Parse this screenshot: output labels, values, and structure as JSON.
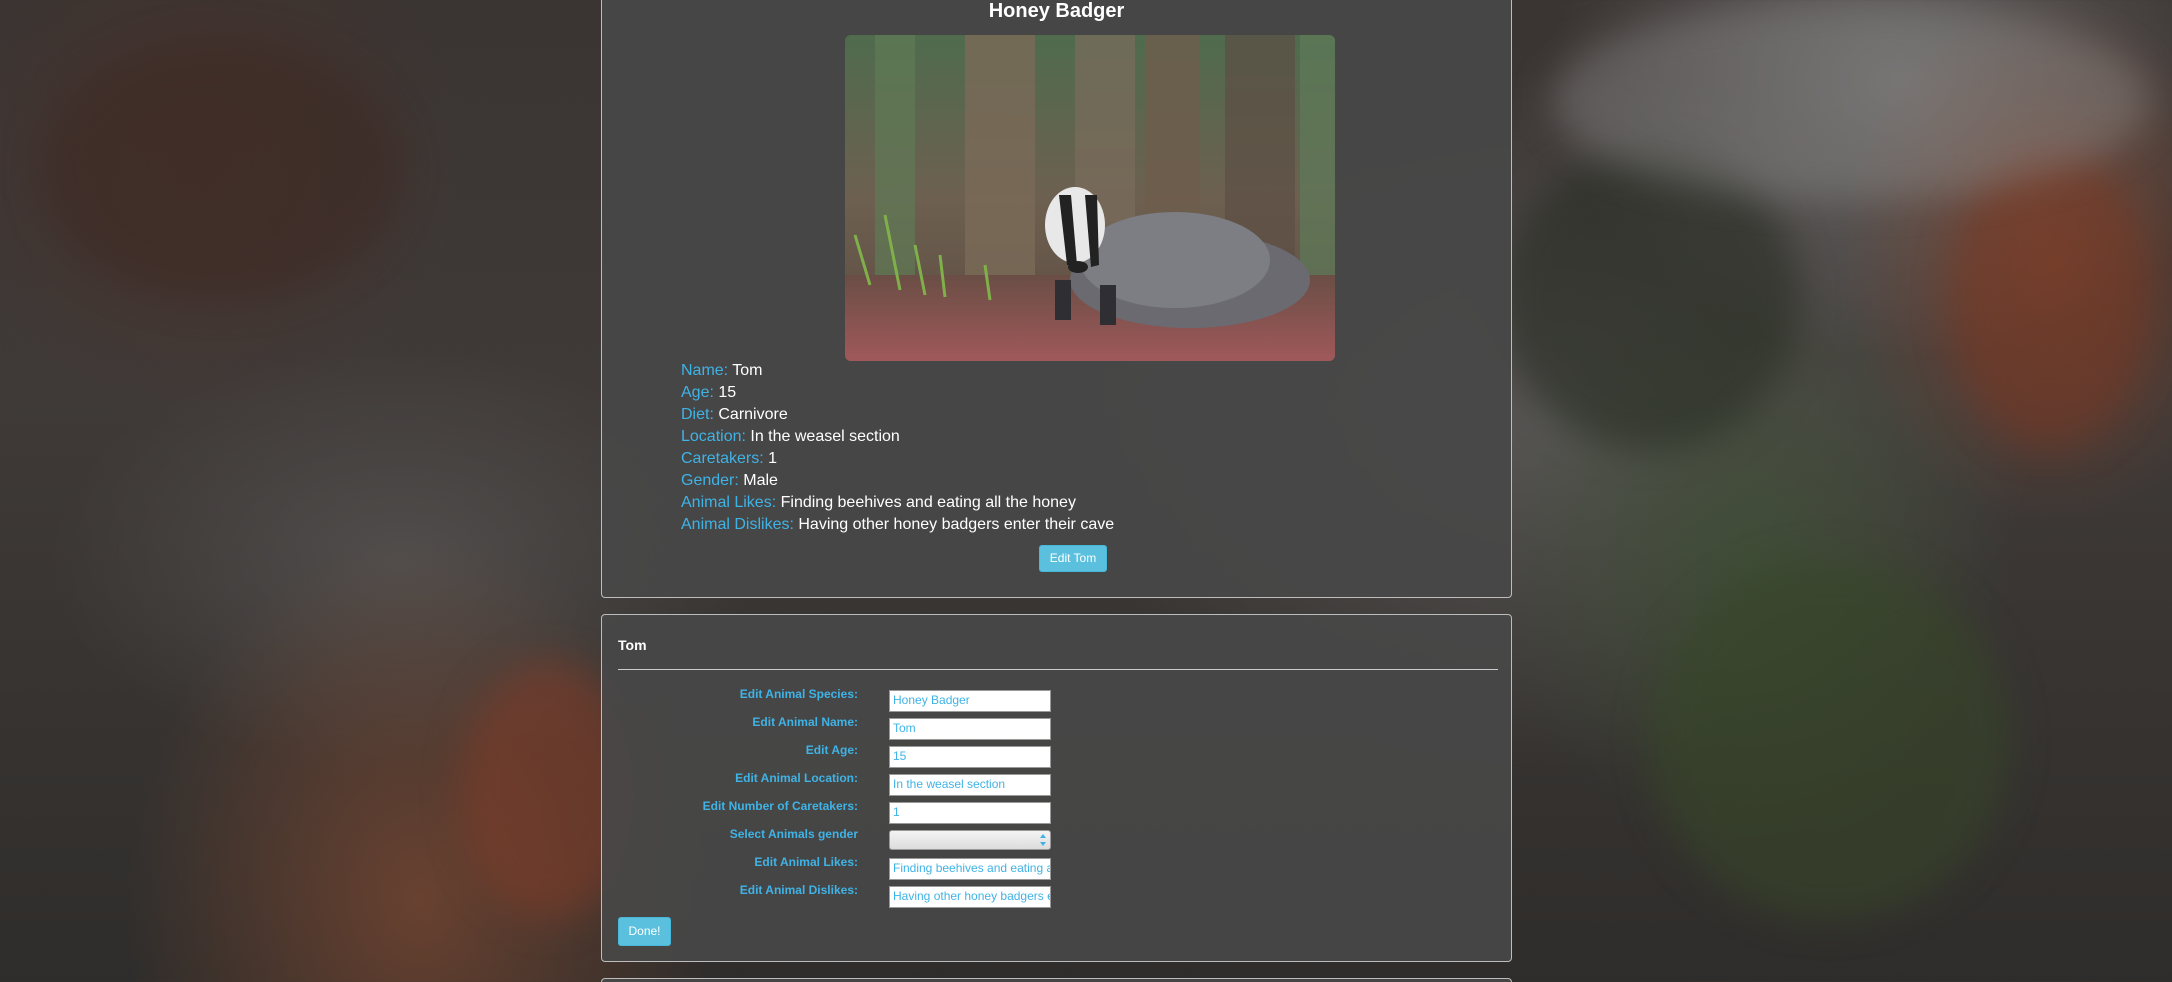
{
  "colors": {
    "label_blue": "#3fb3e6",
    "button_blue": "#5bc0de",
    "card_bg": "#484848",
    "text_white": "#ffffff"
  },
  "animal_card": {
    "species": "Honey Badger",
    "photo": "badger-photo",
    "details": [
      {
        "label": "Name:",
        "value": "Tom"
      },
      {
        "label": "Age:",
        "value": "15"
      },
      {
        "label": "Diet:",
        "value": "Carnivore"
      },
      {
        "label": "Location:",
        "value": "In the weasel section"
      },
      {
        "label": "Caretakers:",
        "value": "1"
      },
      {
        "label": "Gender:",
        "value": "Male"
      },
      {
        "label": "Animal Likes:",
        "value": "Finding beehives and eating all the honey"
      },
      {
        "label": "Animal Dislikes:",
        "value": "Having other honey badgers enter their cave"
      }
    ],
    "edit_button_label": "Edit Tom"
  },
  "edit_form": {
    "heading": "Tom",
    "fields": [
      {
        "label": "Edit Animal Species:",
        "value": "Honey Badger"
      },
      {
        "label": "Edit Animal Name:",
        "value": "Tom"
      },
      {
        "label": "Edit Age:",
        "value": "15"
      },
      {
        "label": "Edit Animal Location:",
        "value": "In the weasel section"
      },
      {
        "label": "Edit Number of Caretakers:",
        "value": "1"
      },
      {
        "label": "Select Animals gender",
        "value": ""
      },
      {
        "label": "Edit Animal Likes:",
        "value": "Finding beehives and eating all the honey"
      },
      {
        "label": "Edit Animal Dislikes:",
        "value": "Having other honey badgers enter their cave"
      }
    ],
    "done_button_label": "Done!"
  }
}
